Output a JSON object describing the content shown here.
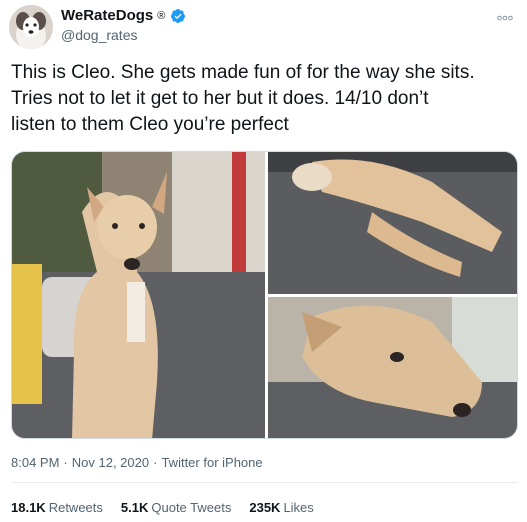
{
  "account": {
    "display_name": "WeRateDogs",
    "registered_mark": "®",
    "handle": "@dog_rates",
    "avatar_icon": "dog-avatar-icon",
    "verified_icon": "verified-badge-icon",
    "verified_color": "#1d9bf0"
  },
  "more_icon": "more-options-icon",
  "tweet": {
    "text": "This is Cleo. She gets made fun of for the way she sits.\nTries not to let it get to her but it does. 14/10 don’t\nlisten to them Cleo you’re perfect"
  },
  "media": {
    "count": 3
  },
  "meta": {
    "time": "8:04 PM",
    "dot1": "·",
    "date": "Nov 12, 2020",
    "dot2": "·",
    "source": "Twitter for iPhone"
  },
  "stats": {
    "retweets_count": "18.1K",
    "retweets_label": "Retweets",
    "quotes_count": "5.1K",
    "quotes_label": "Quote Tweets",
    "likes_count": "235K",
    "likes_label": "Likes"
  }
}
